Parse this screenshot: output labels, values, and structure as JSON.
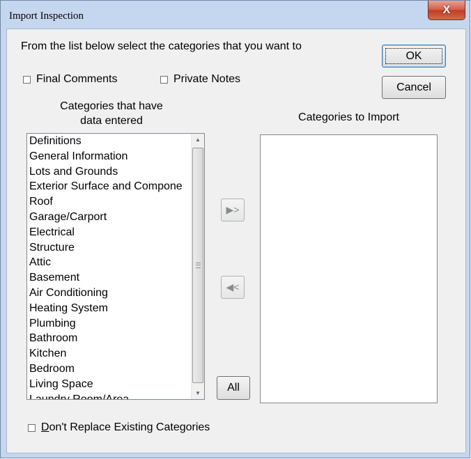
{
  "window": {
    "title": "Import Inspection",
    "close_glyph": "X"
  },
  "instructions": "From the list below select the categories that you want to",
  "checkboxes": {
    "final_comments": "Final Comments",
    "private_notes": "Private Notes",
    "dont_replace": {
      "mnemonic": "D",
      "rest": "on't Replace Existing Categories"
    }
  },
  "buttons": {
    "ok": "OK",
    "cancel": "Cancel",
    "add_glyph": "▶>",
    "remove_glyph": "◀<",
    "all": "All"
  },
  "left_list": {
    "header_line1": "Categories that have",
    "header_line2": "data entered",
    "items": [
      "Definitions",
      "General Information",
      "Lots and Grounds",
      "Exterior Surface and Compone",
      "Roof",
      "Garage/Carport",
      "Electrical",
      "Structure",
      "Attic",
      "Basement",
      "Air Conditioning",
      "Heating System",
      "Plumbing",
      "Bathroom",
      "Kitchen",
      "Bedroom",
      "Living Space",
      "Laundry Room/Area"
    ]
  },
  "right_list": {
    "header": "Categories to Import",
    "items": []
  },
  "icons": {
    "scroll_up": "▲",
    "scroll_down": "▼"
  }
}
